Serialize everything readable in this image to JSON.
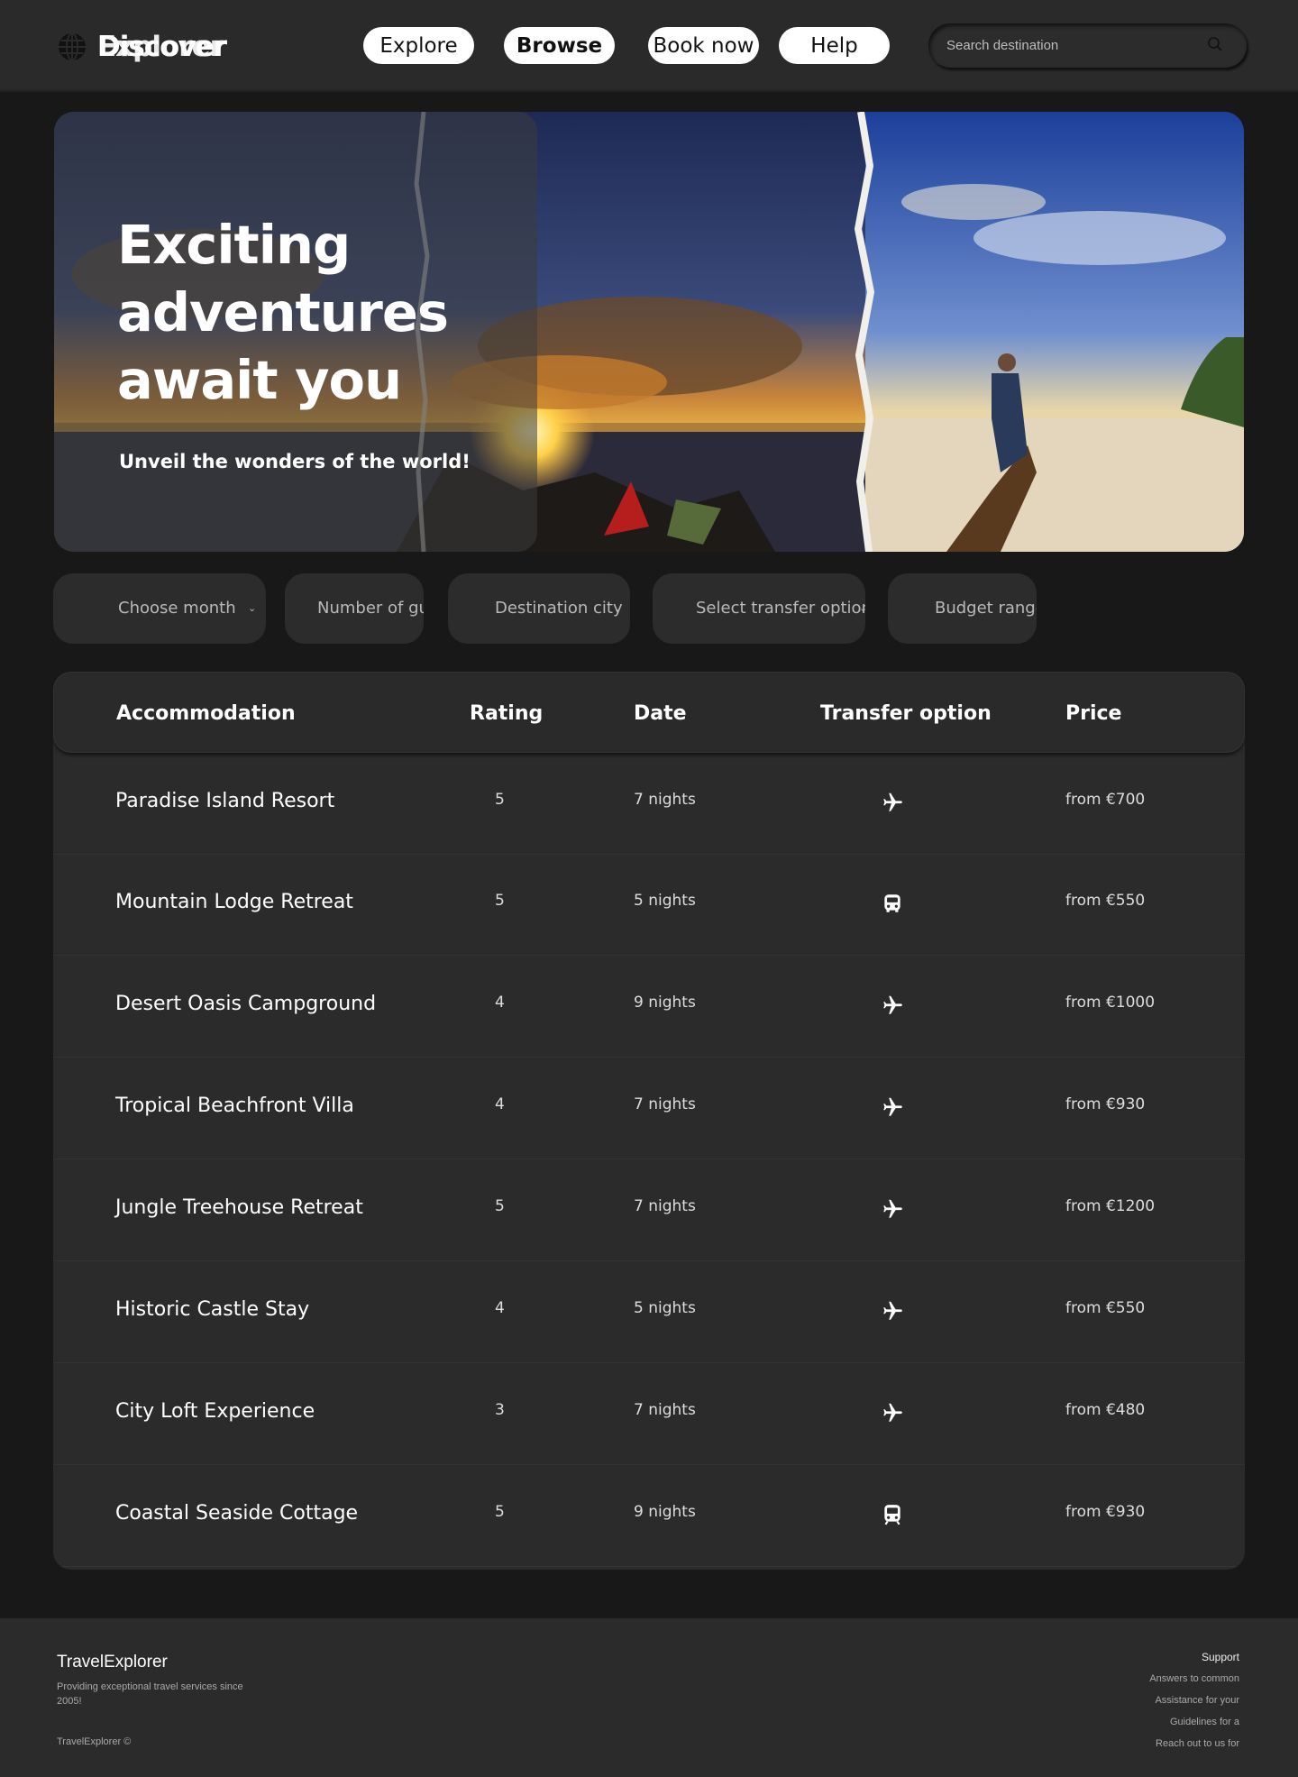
{
  "header": {
    "logo_text_a": "Discover",
    "logo_text_b": "Explorer",
    "nav": [
      {
        "label": "Explore"
      },
      {
        "label": "Browse"
      },
      {
        "label": "Book now"
      },
      {
        "label": "Help"
      }
    ],
    "search_placeholder": "Search destination"
  },
  "hero": {
    "title": "Exciting adventures await you",
    "subtitle": "Unveil the wonders of the world!"
  },
  "filters": [
    {
      "label": "Choose month"
    },
    {
      "label": "Number of guests"
    },
    {
      "label": "Destination city"
    },
    {
      "label": "Select transfer option"
    },
    {
      "label": "Budget range"
    }
  ],
  "table": {
    "headers": [
      "Accommodation",
      "Rating",
      "Date",
      "Transfer option",
      "Price"
    ],
    "rows": [
      {
        "name": "Paradise Island Resort",
        "rating": "5",
        "date": "7 nights",
        "transfer": "plane-icon",
        "price": "from €700"
      },
      {
        "name": "Mountain Lodge Retreat",
        "rating": "5",
        "date": "5 nights",
        "transfer": "bus-icon",
        "price": "from €550"
      },
      {
        "name": "Desert Oasis Campground",
        "rating": "4",
        "date": "9 nights",
        "transfer": "plane-icon",
        "price": "from €1000"
      },
      {
        "name": "Tropical Beachfront Villa",
        "rating": "4",
        "date": "7 nights",
        "transfer": "plane-icon",
        "price": "from €930"
      },
      {
        "name": "Jungle Treehouse Retreat",
        "rating": "5",
        "date": "7 nights",
        "transfer": "plane-icon",
        "price": "from €1200"
      },
      {
        "name": "Historic Castle Stay",
        "rating": "4",
        "date": "5 nights",
        "transfer": "plane-icon",
        "price": "from €550"
      },
      {
        "name": "City Loft Experience",
        "rating": "3",
        "date": "7 nights",
        "transfer": "plane-icon",
        "price": "from €480"
      },
      {
        "name": "Coastal Seaside Cottage",
        "rating": "5",
        "date": "9 nights",
        "transfer": "train-icon",
        "price": "from €930"
      }
    ]
  },
  "footer": {
    "brand": "TravelExplorer",
    "tagline": "Providing exceptional travel services since 2005!",
    "copyright": "TravelExplorer ©",
    "support_title": "Support",
    "support_links": [
      "Answers to common",
      "Assistance for your",
      "Guidelines for a",
      "Reach out to us for"
    ]
  },
  "colors": {
    "background": "#181818",
    "surface": "#2b2b2b",
    "nav_button": "#ffffff",
    "text": "#ffffff"
  }
}
